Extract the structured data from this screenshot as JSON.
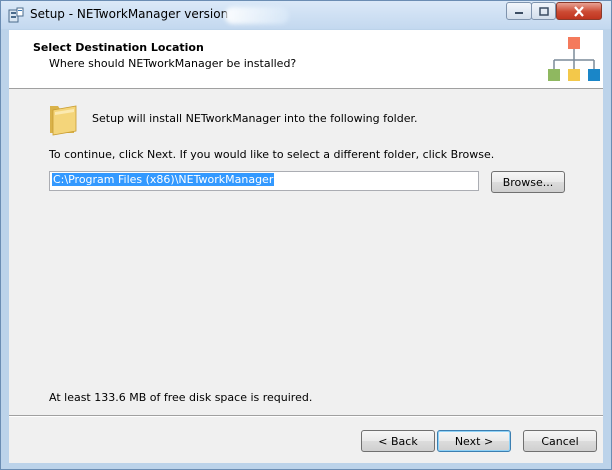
{
  "window": {
    "title": "Setup - NETworkManager version",
    "caption_buttons": {
      "minimize": "—",
      "maximize": "□",
      "close": "✕"
    }
  },
  "header": {
    "title": "Select Destination Location",
    "subtitle": "Where should NETworkManager be installed?",
    "graphic_colors": {
      "top": "#f47a5c",
      "left": "#8fb860",
      "middle": "#f3c84a",
      "right": "#1a86c8"
    }
  },
  "body": {
    "install_text": "Setup will install NETworkManager into the following folder.",
    "continue_text": "To continue, click Next. If you would like to select a different folder, click Browse.",
    "path_value": "C:\\Program Files (x86)\\NETworkManager",
    "browse_label": "Browse...",
    "disk_space_text": "At least 133.6 MB of free disk space is required."
  },
  "footer": {
    "back_label": "< Back",
    "next_label": "Next >",
    "cancel_label": "Cancel"
  }
}
